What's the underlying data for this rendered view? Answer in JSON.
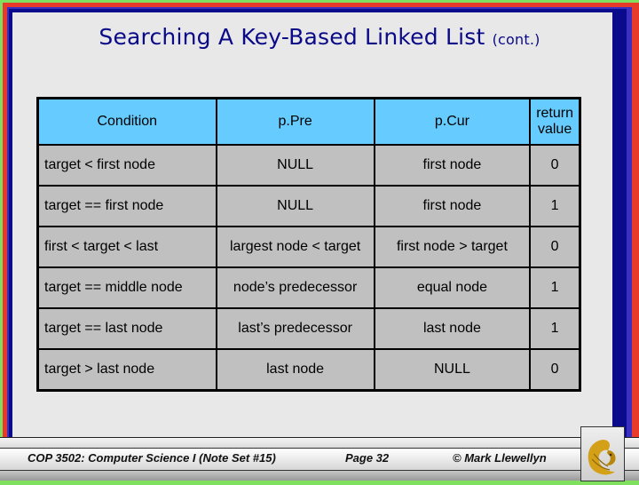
{
  "slide": {
    "title": "Searching A Key-Based Linked List",
    "title_suffix": "(cont.)"
  },
  "table": {
    "headers": [
      "Condition",
      "p.Pre",
      "p.Cur",
      "return value"
    ],
    "header_return_line1": "return",
    "header_return_line2": "value",
    "rows": [
      [
        "target < first node",
        "NULL",
        "first node",
        "0"
      ],
      [
        "target == first node",
        "NULL",
        "first node",
        "1"
      ],
      [
        "first < target < last",
        "largest node < target",
        "first node > target",
        "0"
      ],
      [
        "target == middle node",
        "node’s predecessor",
        "equal node",
        "1"
      ],
      [
        "target == last node",
        "last’s predecessor",
        "last node",
        "1"
      ],
      [
        "target > last node",
        "last node",
        "NULL",
        "0"
      ]
    ]
  },
  "footer": {
    "course": "COP 3502: Computer Science I  (Note Set #15)",
    "page": "Page 32",
    "copyright": "© Mark Llewellyn",
    "logo": "pegasus-logo-icon"
  },
  "colors": {
    "title": "#0a0a88",
    "header_bg": "#66ccff",
    "cell_bg": "#c0c0c0",
    "slide_bg": "#e8e8e8",
    "logo_gold": "#d4a017"
  }
}
